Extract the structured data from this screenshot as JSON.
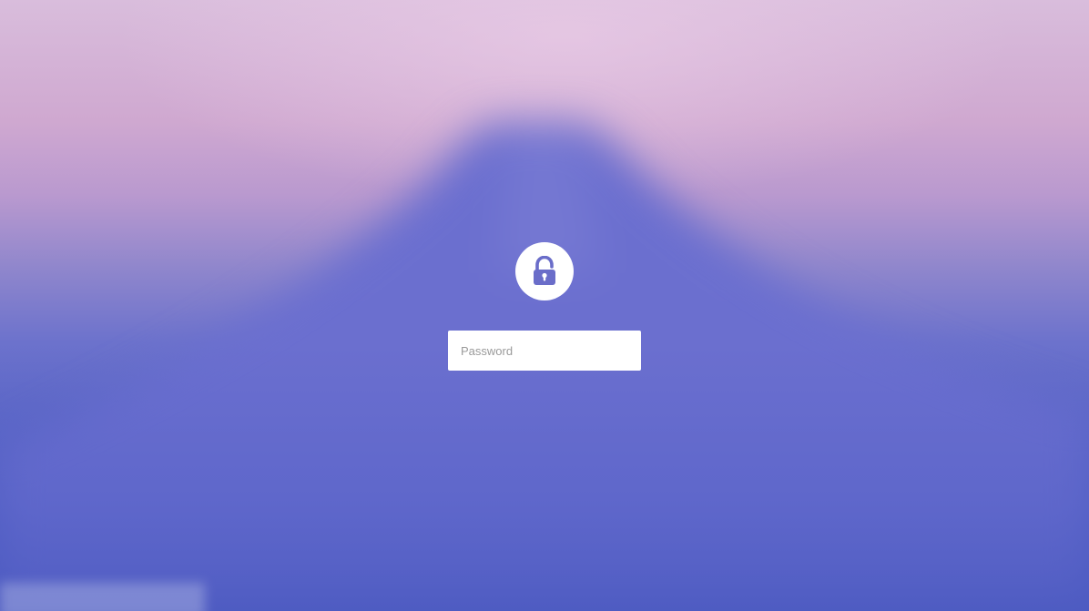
{
  "background": {
    "sky_color": "#d9bddc",
    "mountain_color": "#6b6fcf",
    "base_color": "#4a5ac0"
  },
  "lock": {
    "icon": "padlock-unlocked-icon",
    "circle_color": "#ffffff",
    "icon_color": "#6a6dc9"
  },
  "login": {
    "password_placeholder": "Password",
    "password_value": ""
  }
}
